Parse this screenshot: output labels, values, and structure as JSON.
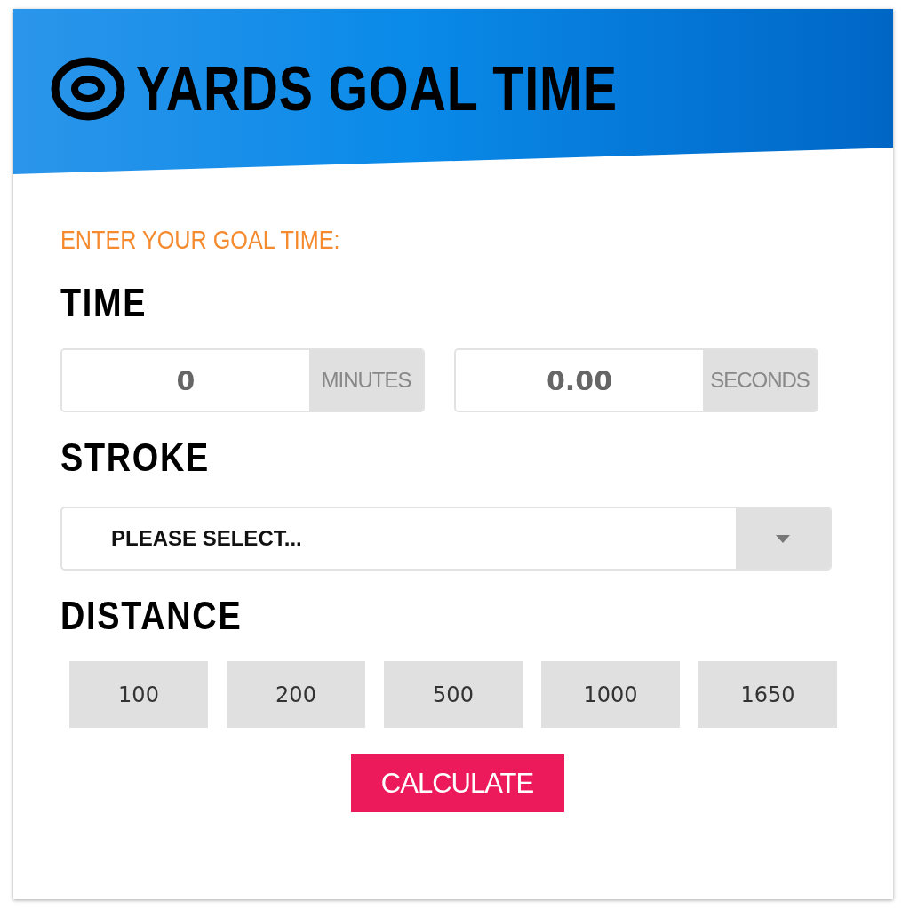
{
  "header": {
    "title": "YARDS GOAL TIME"
  },
  "prompt": "ENTER YOUR GOAL TIME:",
  "time": {
    "heading": "TIME",
    "fields": [
      {
        "value": "0",
        "unit": "MINUTES"
      },
      {
        "value": "0.00",
        "unit": "SECONDS"
      }
    ]
  },
  "stroke": {
    "heading": "STROKE",
    "select": {
      "value": "PLEASE SELECT..."
    }
  },
  "distance": {
    "heading": "DISTANCE",
    "options": [
      {
        "label": "100",
        "selected": false
      },
      {
        "label": "200",
        "selected": false
      },
      {
        "label": "500",
        "selected": false
      },
      {
        "label": "1000",
        "selected": false
      },
      {
        "label": "1650",
        "selected": false
      }
    ]
  },
  "calculate_button": "CALCULATE"
}
